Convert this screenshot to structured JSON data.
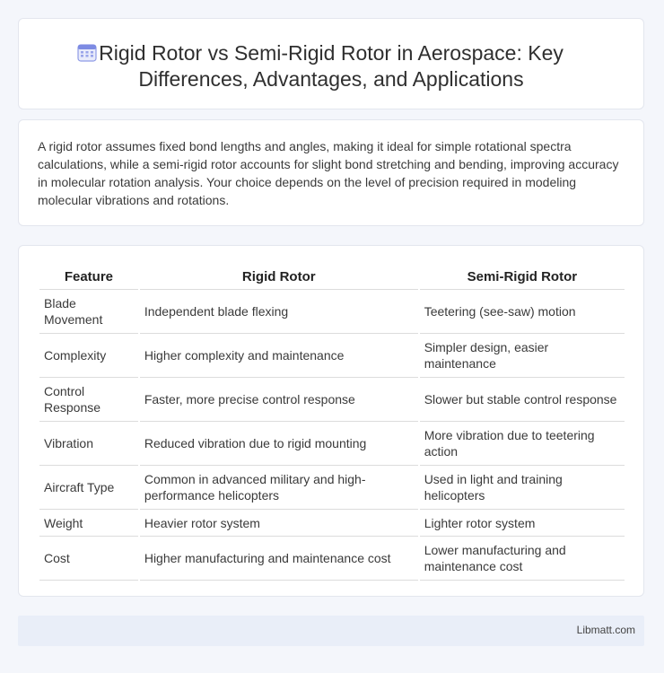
{
  "header": {
    "title": "Rigid Rotor vs Semi-Rigid Rotor in Aerospace: Key Differences, Advantages, and Applications",
    "icon": "calendar-icon",
    "icon_color": "#6f7fe0"
  },
  "intro": {
    "text": "A rigid rotor assumes fixed bond lengths and angles, making it ideal for simple rotational spectra calculations, while a semi-rigid rotor accounts for slight bond stretching and bending, improving accuracy in molecular rotation analysis. Your choice depends on the level of precision required in modeling molecular vibrations and rotations."
  },
  "table": {
    "headers": [
      "Feature",
      "Rigid Rotor",
      "Semi-Rigid Rotor"
    ],
    "rows": [
      [
        "Blade Movement",
        "Independent blade flexing",
        "Teetering (see-saw) motion"
      ],
      [
        "Complexity",
        "Higher complexity and maintenance",
        "Simpler design, easier maintenance"
      ],
      [
        "Control Response",
        "Faster, more precise control response",
        "Slower but stable control response"
      ],
      [
        "Vibration",
        "Reduced vibration due to rigid mounting",
        "More vibration due to teetering action"
      ],
      [
        "Aircraft Type",
        "Common in advanced military and high-performance helicopters",
        "Used in light and training helicopters"
      ],
      [
        "Weight",
        "Heavier rotor system",
        "Lighter rotor system"
      ],
      [
        "Cost",
        "Higher manufacturing and maintenance cost",
        "Lower manufacturing and maintenance cost"
      ]
    ]
  },
  "footer": {
    "brand": "Libmatt.com"
  }
}
